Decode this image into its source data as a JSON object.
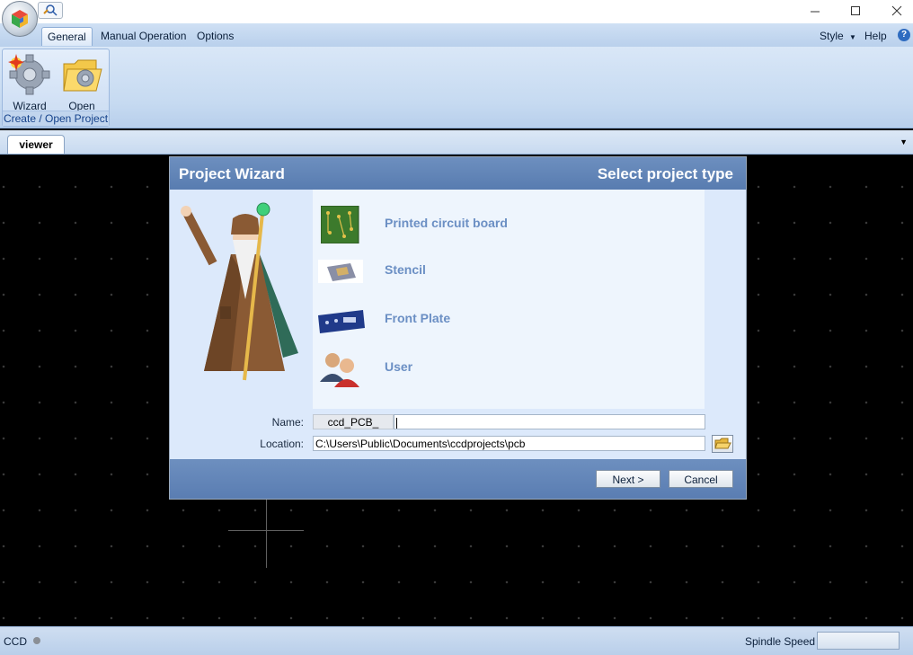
{
  "menu": {
    "tabs": [
      {
        "label": "General",
        "active": true
      },
      {
        "label": "Manual Operation",
        "active": false
      },
      {
        "label": "Options",
        "active": false
      }
    ],
    "style_label": "Style",
    "help_label": "Help"
  },
  "ribbon": {
    "wizard_label": "Wizard",
    "open_label": "Open",
    "group_label": "Create / Open Project"
  },
  "document_tab": {
    "label": "viewer"
  },
  "wizard": {
    "title": "Project Wizard",
    "subtitle": "Select project type",
    "types": [
      {
        "label": "Printed circuit board",
        "icon": "pcb-icon"
      },
      {
        "label": "Stencil",
        "icon": "stencil-icon"
      },
      {
        "label": "Front Plate",
        "icon": "front-plate-icon"
      },
      {
        "label": "User",
        "icon": "users-icon"
      }
    ],
    "name_label": "Name:",
    "name_prefix": "ccd_PCB_",
    "name_value": "",
    "location_label": "Location:",
    "location_value": "C:\\Users\\Public\\Documents\\ccdprojects\\pcb",
    "next_label": "Next >",
    "cancel_label": "Cancel"
  },
  "status": {
    "left": "CCD",
    "spindle_label": "Spindle Speed",
    "spindle_value": ""
  }
}
